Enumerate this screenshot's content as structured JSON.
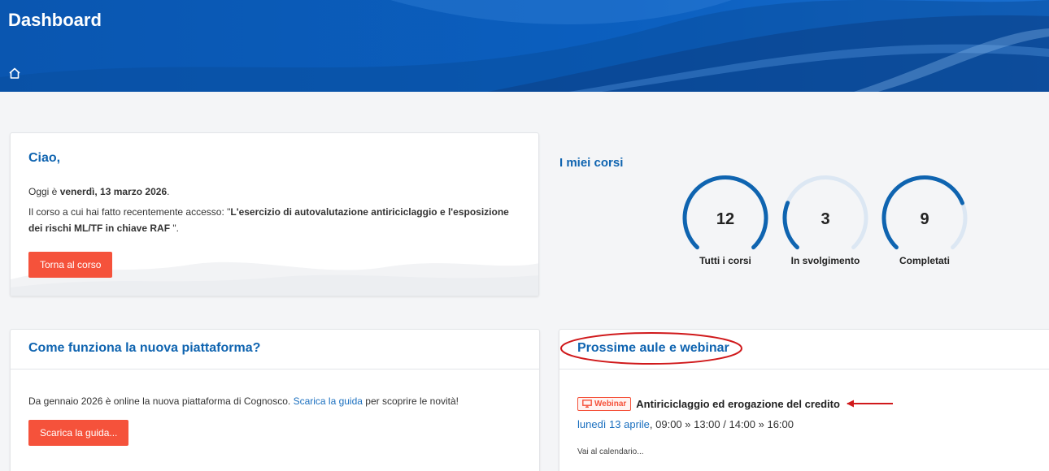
{
  "header": {
    "title": "Dashboard",
    "home_icon": "home-icon"
  },
  "welcome": {
    "greeting": "Ciao,",
    "today_prefix": "Oggi è ",
    "today_date": "venerdì, 13 marzo 2026",
    "today_suffix": ".",
    "last_prefix": "Il corso a cui hai fatto recentemente accesso: \"",
    "last_course": "L'esercizio di autovalutazione antiriciclaggio e l'esposizione dei rischi ML/TF in chiave RAF",
    "last_suffix": " \".",
    "button": "Torna al corso"
  },
  "courses": {
    "title": "I miei corsi",
    "stats": [
      {
        "value": "12",
        "label": "Tutti i corsi",
        "progress": 1.0
      },
      {
        "value": "3",
        "label": "In svolgimento",
        "progress": 0.25
      },
      {
        "value": "9",
        "label": "Completati",
        "progress": 0.75
      }
    ]
  },
  "guide": {
    "title": "Come funziona la nuova piattaforma?",
    "text_prefix": "Da gennaio 2026 è online la nuova piattaforma di Cognosco. ",
    "link": "Scarica la guida",
    "text_suffix": " per scoprire le novità!",
    "button": "Scarica la guida..."
  },
  "webinar": {
    "title": "Prossime aule e webinar",
    "badge": "Webinar",
    "event_title": "Antiriciclaggio ed erogazione del credito",
    "date_link": "lunedì 13 aprile",
    "time": ", 09:00 » 13:00 / 14:00 » 16:00",
    "calendar_link": "Vai al calendario..."
  },
  "colors": {
    "brand_blue": "#0f64b0",
    "accent": "#f5523b",
    "annotation_red": "#d0191b"
  }
}
